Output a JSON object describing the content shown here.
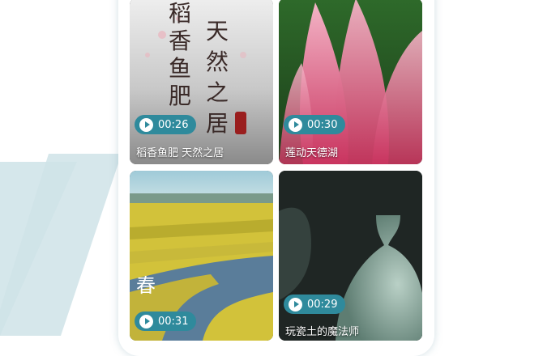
{
  "videos": [
    {
      "duration": "00:26",
      "title": "稻香鱼肥 天然之居"
    },
    {
      "duration": "00:30",
      "title": "莲动天德湖"
    },
    {
      "duration": "00:31",
      "title": ""
    },
    {
      "duration": "00:29",
      "title": "玩瓷土的魔法师"
    }
  ],
  "colors": {
    "duration_badge": "#2f8a9c",
    "background_logo": "#cfe3e8",
    "phone_shadow": "#9fc0ca"
  },
  "icons": {
    "duration": "play-icon"
  }
}
